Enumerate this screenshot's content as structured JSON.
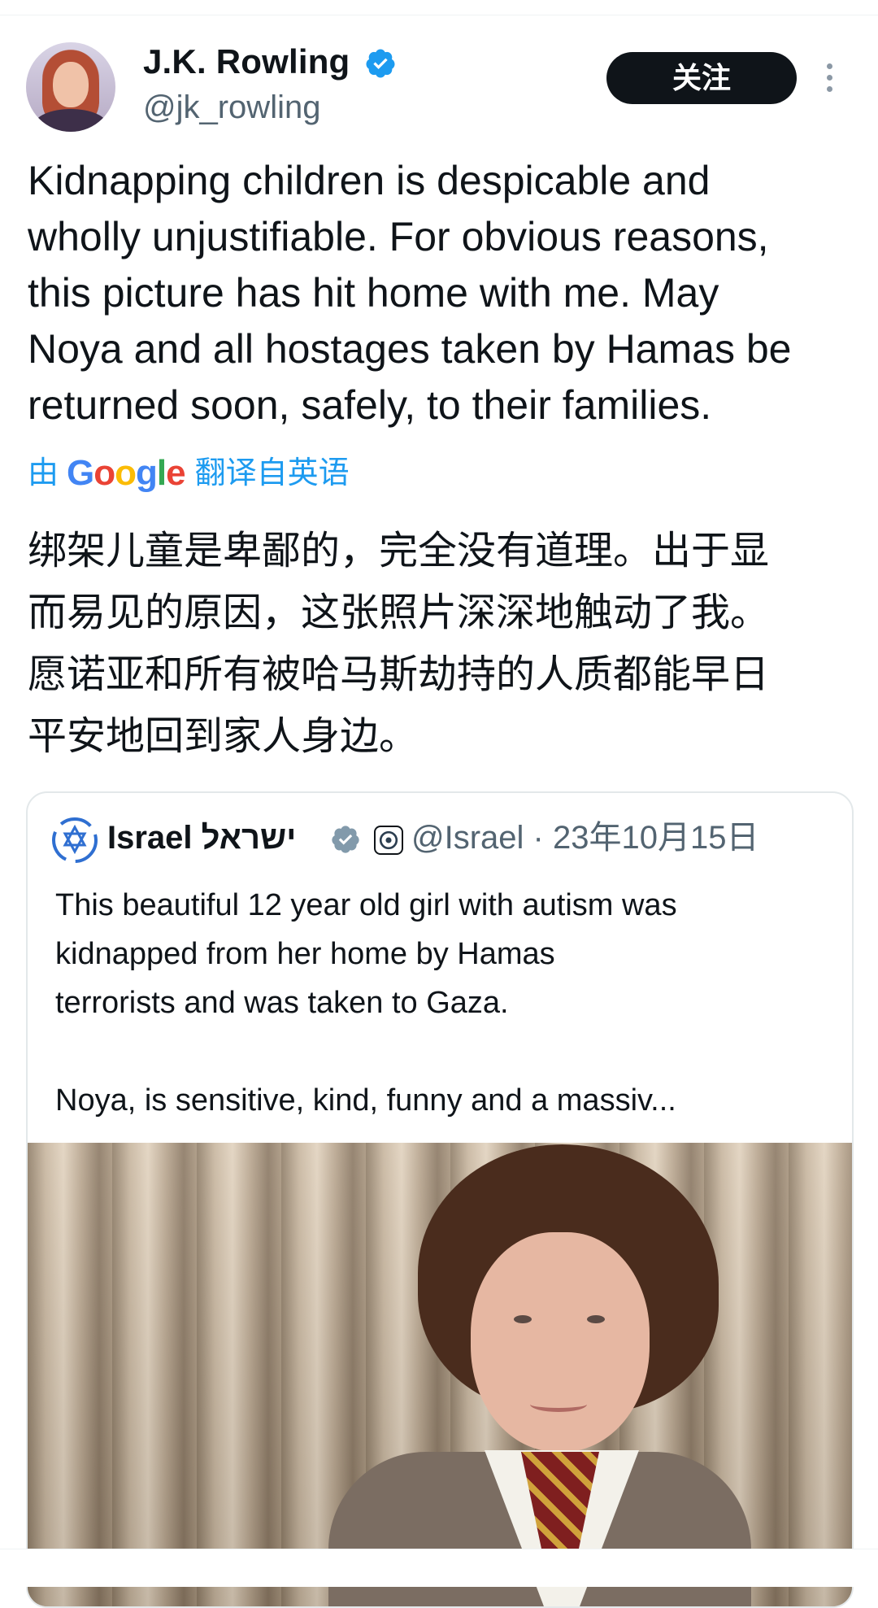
{
  "author": {
    "name": "J.K. Rowling",
    "handle": "@jk_rowling",
    "verified": true
  },
  "follow_button_label": "关注",
  "tweet_text": "Kidnapping children is despicable and\nwholly unjustifiable. For obvious reasons,\nthis picture has hit home with me. May\nNoya and all hostages taken by Hamas be\nreturned soon, safely, to their families.",
  "translation": {
    "prefix": "由",
    "brand_letters": [
      "G",
      "o",
      "o",
      "g",
      "l",
      "e"
    ],
    "suffix": "翻译自英语",
    "text": "绑架儿童是卑鄙的，完全没有道理。出于显\n而易见的原因，这张照片深深地触动了我。\n愿诺亚和所有被哈马斯劫持的人质都能早日\n平安地回到家人身边。"
  },
  "quoted_tweet": {
    "author_name": "Israel ישראל",
    "meta": "@Israel · 23年10月15日",
    "text": "This beautiful 12 year old girl with autism was\nkidnapped from her home by Hamas\nterrorists and was taken to Gaza.\n\nNoya, is sensitive, kind, funny and a massiv...",
    "verified_color": "#829aab"
  },
  "colors": {
    "accent": "#1d9bf0",
    "text": "#0f1419",
    "secondary": "#536471",
    "button_bg": "#0f1419"
  },
  "icons": [
    "verified-badge-icon",
    "more-options-icon",
    "star-of-david-icon",
    "government-badge-icon"
  ]
}
